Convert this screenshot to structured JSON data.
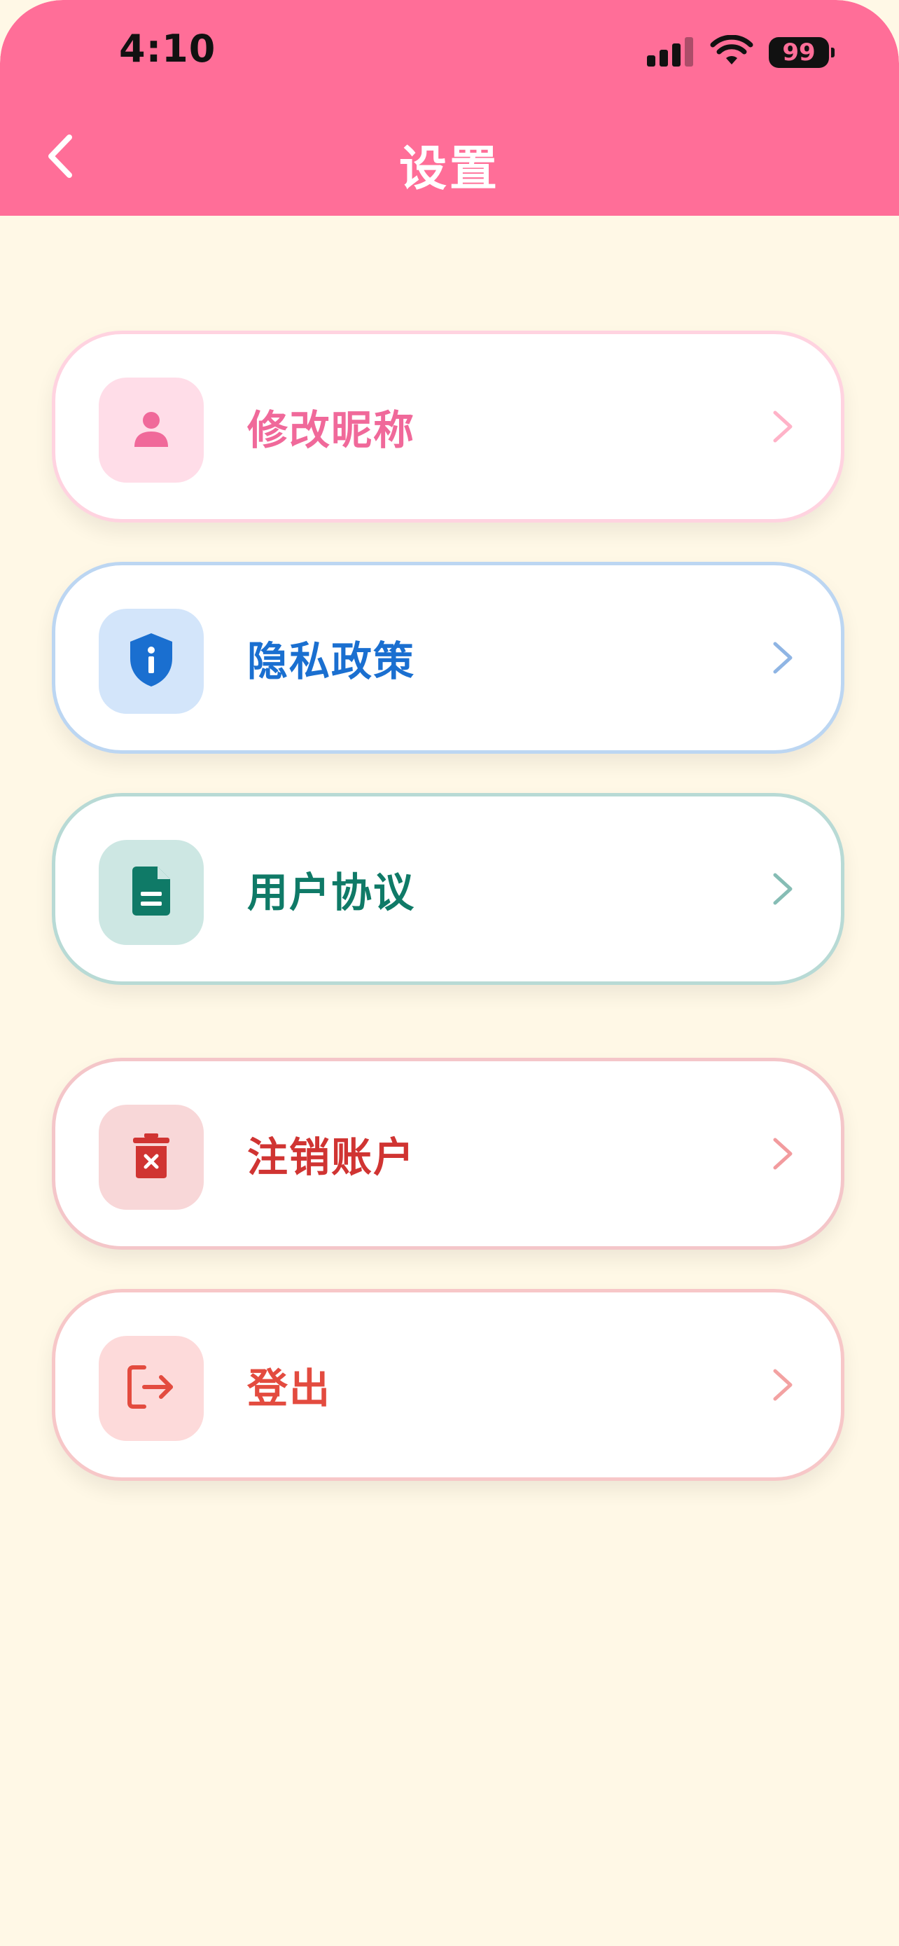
{
  "status_bar": {
    "time": "4:10",
    "battery": "99"
  },
  "header": {
    "title": "设置",
    "background": "#ff6e98"
  },
  "items": [
    {
      "label": "修改昵称",
      "icon": "person-icon",
      "text_color": "#f0699a",
      "border_color": "#ffd3e0",
      "icon_bg": "#ffdde8",
      "icon_color": "#f0699a",
      "chevron_color": "#ffb3c8"
    },
    {
      "label": "隐私政策",
      "icon": "shield-info-icon",
      "text_color": "#1a6fd0",
      "border_color": "#bcd6f2",
      "icon_bg": "#d3e5fa",
      "icon_color": "#1a6fd0",
      "chevron_color": "#8fb5e4"
    },
    {
      "label": "用户协议",
      "icon": "document-icon",
      "text_color": "#0f7a67",
      "border_color": "#b8dad5",
      "icon_bg": "#cde7e3",
      "icon_color": "#0f7a67",
      "chevron_color": "#86bdb5"
    },
    {
      "label": "注销账户",
      "icon": "delete-account-icon",
      "text_color": "#d03432",
      "border_color": "#f4c6c9",
      "icon_bg": "#f8d7d8",
      "icon_color": "#d03432",
      "chevron_color": "#f29b9e"
    },
    {
      "label": "登出",
      "icon": "logout-icon",
      "text_color": "#e34b3f",
      "border_color": "#f7c7c8",
      "icon_bg": "#fddada",
      "icon_color": "#e34b3f",
      "chevron_color": "#f3a2a2"
    }
  ]
}
